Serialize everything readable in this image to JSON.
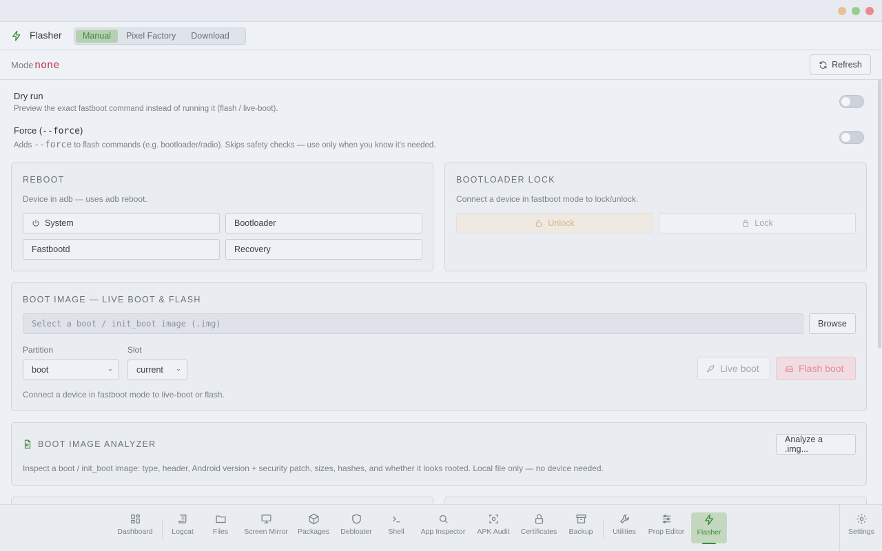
{
  "window": {
    "controls": [
      {
        "name": "minimize",
        "color": "#e9c08e"
      },
      {
        "name": "maximize",
        "color": "#95cf8e"
      },
      {
        "name": "close",
        "color": "#e88a8f"
      }
    ]
  },
  "header": {
    "app_icon": "lightning-icon",
    "title": "Flasher",
    "tabs": [
      {
        "label": "Manual",
        "active": true
      },
      {
        "label": "Pixel Factory",
        "active": false
      },
      {
        "label": "Download",
        "active": false
      }
    ]
  },
  "modebar": {
    "label": "Mode",
    "value": "none",
    "refresh_label": "Refresh",
    "refresh_icon": "refresh-icon"
  },
  "toggles": {
    "dry_run": {
      "title": "Dry run",
      "desc": "Preview the exact fastboot command instead of running it (flash / live-boot).",
      "on": false
    },
    "force": {
      "title_prefix": "Force (",
      "title_code": "--force",
      "title_suffix": ")",
      "desc_prefix": "Adds ",
      "desc_code": "--force",
      "desc_suffix": " to flash commands (e.g. bootloader/radio). Skips safety checks — use only when you know it's needed.",
      "on": false
    }
  },
  "reboot": {
    "title": "REBOOT",
    "subtitle": "Device in adb — uses adb reboot.",
    "buttons": {
      "system": "System",
      "bootloader": "Bootloader",
      "fastbootd": "Fastbootd",
      "recovery": "Recovery"
    }
  },
  "bootloader_lock": {
    "title": "BOOTLOADER LOCK",
    "subtitle": "Connect a device in fastboot mode to lock/unlock.",
    "unlock_label": "Unlock",
    "lock_label": "Lock"
  },
  "boot_image": {
    "title": "BOOT IMAGE — LIVE BOOT & FLASH",
    "input_placeholder": "Select a boot / init_boot image (.img)",
    "browse_label": "Browse",
    "partition_label": "Partition",
    "partition_value": "boot",
    "slot_label": "Slot",
    "slot_value": "current",
    "live_boot_label": "Live boot",
    "flash_boot_label": "Flash boot",
    "footer": "Connect a device in fastboot mode to live-boot or flash."
  },
  "analyzer": {
    "title": "BOOT IMAGE ANALYZER",
    "button_label": "Analyze a .img...",
    "desc": "Inspect a boot / init_boot image: type, header, Android version + security patch, sizes, hashes, and whether it looks rooted. Local file only — no device needed."
  },
  "nav": {
    "items": [
      {
        "label": "Dashboard",
        "icon": "grid-icon"
      },
      {
        "label": "Logcat",
        "icon": "scroll-icon"
      },
      {
        "label": "Files",
        "icon": "folder-icon"
      },
      {
        "label": "Screen Mirror",
        "icon": "cast-icon"
      },
      {
        "label": "Packages",
        "icon": "package-icon"
      },
      {
        "label": "Debloater",
        "icon": "shield-icon"
      },
      {
        "label": "Shell",
        "icon": "terminal-icon"
      },
      {
        "label": "App Inspector",
        "icon": "search-icon"
      },
      {
        "label": "APK Audit",
        "icon": "scan-icon"
      },
      {
        "label": "Certificates",
        "icon": "lock-icon"
      },
      {
        "label": "Backup",
        "icon": "archive-icon"
      },
      {
        "label": "Utilities",
        "icon": "wrench-icon"
      },
      {
        "label": "Prop Editor",
        "icon": "sliders-icon"
      },
      {
        "label": "Flasher",
        "icon": "lightning-icon",
        "active": true
      }
    ],
    "settings_label": "Settings",
    "settings_icon": "gear-icon"
  },
  "colors": {
    "accent_green": "#3d8a3d",
    "mode_red": "#c2334b",
    "flash_pink": "#e48a9c",
    "unlock_amber": "#e0b37a"
  }
}
